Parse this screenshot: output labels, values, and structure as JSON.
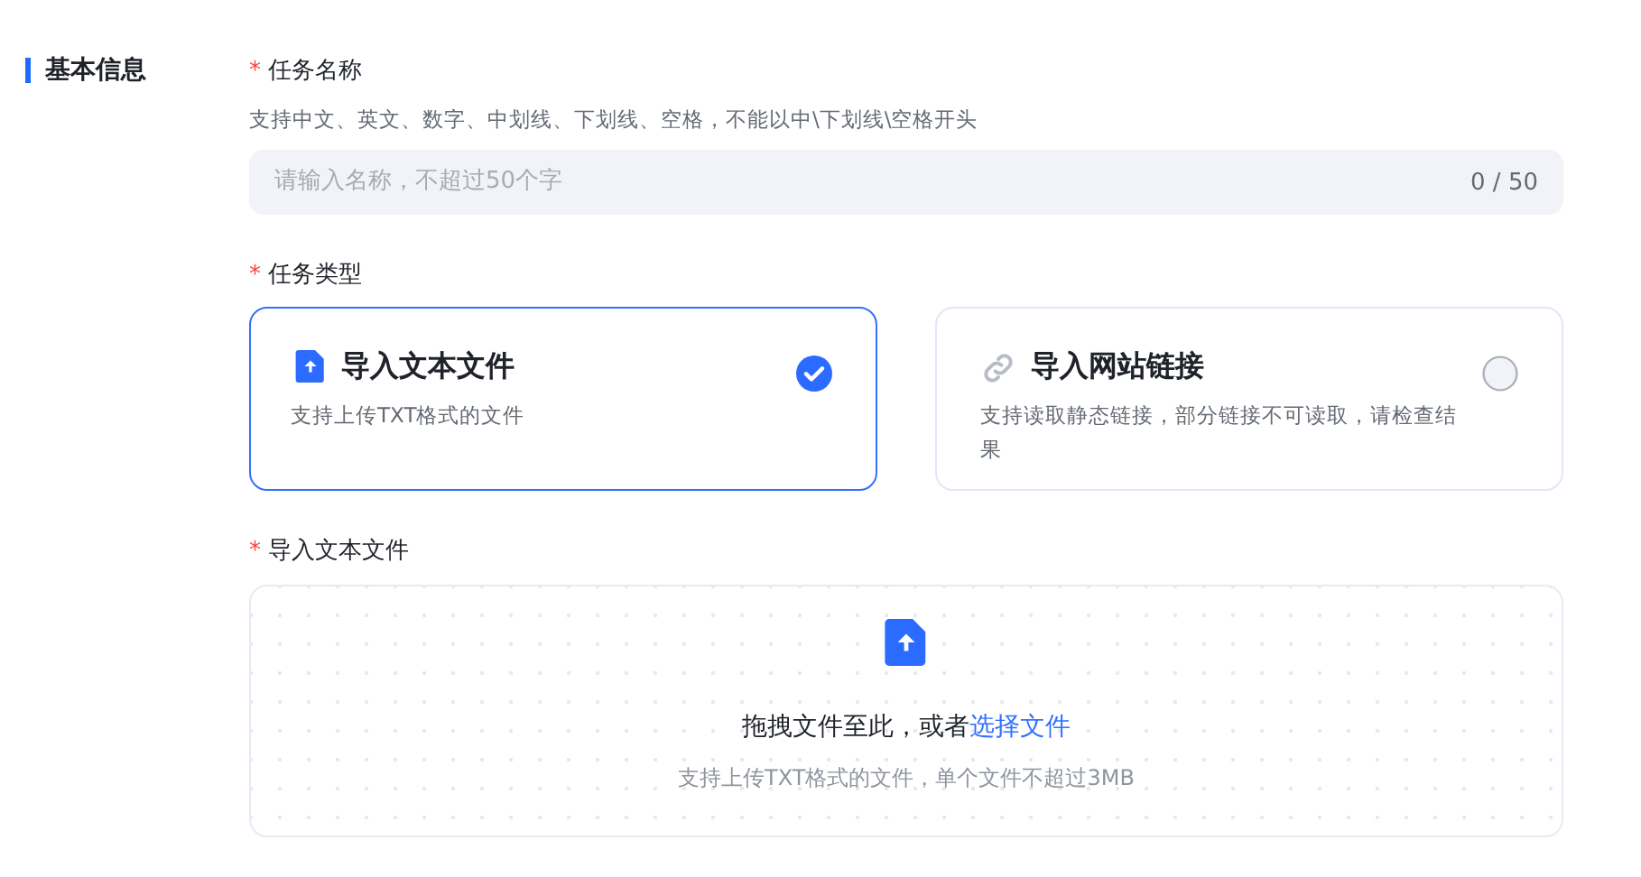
{
  "section": {
    "title": "基本信息"
  },
  "name_field": {
    "label": "任务名称",
    "required_mark": "*",
    "hint": "支持中文、英文、数字、中划线、下划线、空格，不能以中\\下划线\\空格开头",
    "placeholder": "请输入名称，不超过50个字",
    "counter": "0 / 50"
  },
  "type_field": {
    "label": "任务类型",
    "required_mark": "*",
    "options": [
      {
        "kind": "file",
        "title": "导入文本文件",
        "description": "支持上传TXT格式的文件",
        "selected": true
      },
      {
        "kind": "link",
        "title": "导入网站链接",
        "description": "支持读取静态链接，部分链接不可读取，请检查结果",
        "selected": false
      }
    ]
  },
  "upload_field": {
    "label": "导入文本文件",
    "required_mark": "*",
    "prompt": "拖拽文件至此，或者",
    "link": "选择文件",
    "hint": "支持上传TXT格式的文件，单个文件不超过3MB"
  }
}
